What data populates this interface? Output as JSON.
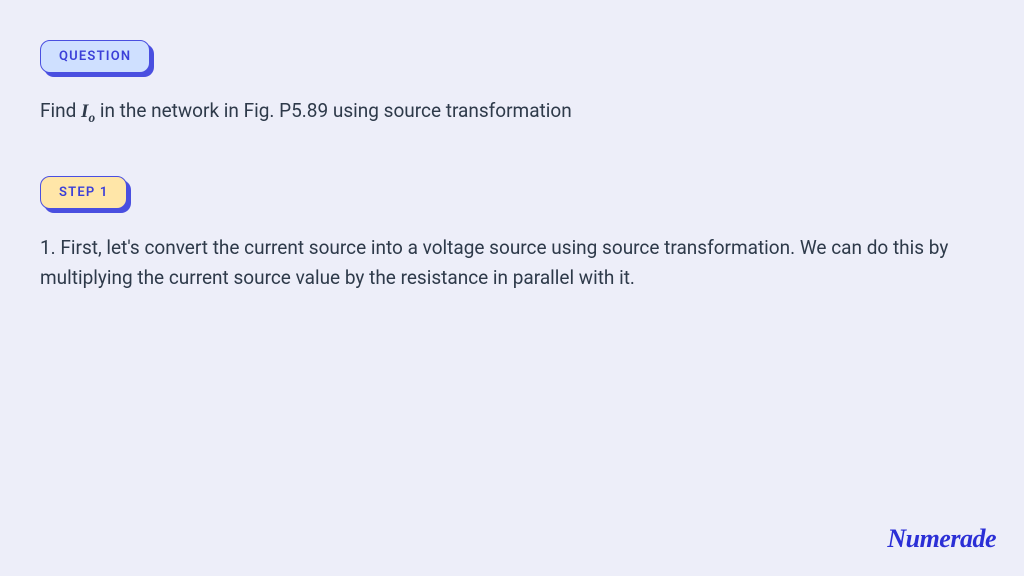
{
  "badges": {
    "question": "QUESTION",
    "step1": "STEP 1"
  },
  "question": {
    "prefix": "Find ",
    "var": "I",
    "sub": "o",
    "suffix": " in the network in Fig. P5.89 using source transformation"
  },
  "step1_text": "1. First, let's convert the current source into a voltage source using source transformation. We can do this by multiplying the current source value by the resistance in parallel with it.",
  "brand": "Numerade"
}
